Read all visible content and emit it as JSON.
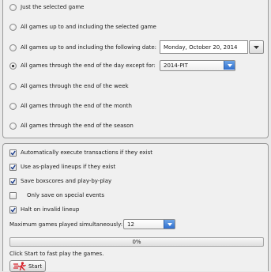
{
  "scope": {
    "options": [
      {
        "label": "Just the selected game",
        "selected": false
      },
      {
        "label": "All games up to and including the selected game",
        "selected": false
      },
      {
        "label": "All games up to and including the following date:",
        "selected": false
      },
      {
        "label": "All games through the end of the day except for:",
        "selected": true
      },
      {
        "label": "All games through the end of the week",
        "selected": false
      },
      {
        "label": "All games through the end of the month",
        "selected": false
      },
      {
        "label": "All games through the end of the season",
        "selected": false
      }
    ],
    "date_value": "Monday, October 20, 2014",
    "except_value": "2014-PIT"
  },
  "settings": {
    "auto_transactions": {
      "label": "Automatically execute transactions if they exist",
      "checked": true
    },
    "as_played_lineups": {
      "label": "Use as-played lineups if they exist",
      "checked": true
    },
    "save_boxscores": {
      "label": "Save boxscores and play-by-play",
      "checked": true
    },
    "special_events": {
      "label": "Only save on special events",
      "checked": false
    },
    "halt_invalid": {
      "label": "Halt on invalid lineup",
      "checked": true
    },
    "max_games_label": "Maximum games played simultaneously:",
    "max_games_value": "12"
  },
  "progress": {
    "value": 0,
    "label": "0%"
  },
  "status_text": "Click Start to fast play the games.",
  "start_button": {
    "label": "Start",
    "icon": "fast-forward-runner-icon"
  },
  "colors": {
    "accent": "#2f6fcf",
    "start_icon": "#d8202a"
  }
}
